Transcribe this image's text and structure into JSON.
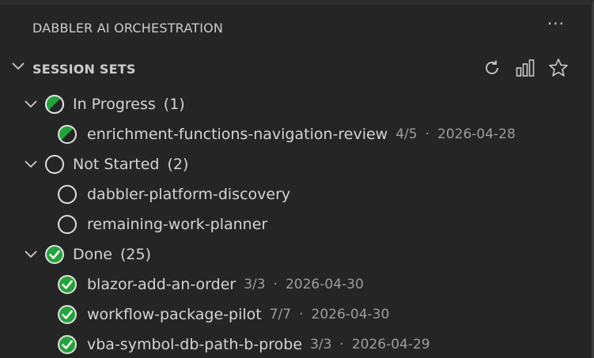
{
  "header": {
    "title": "DABBLER AI ORCHESTRATION",
    "more_label": "···",
    "more_icon": "ellipsis-icon"
  },
  "section": {
    "title": "SESSION SETS",
    "actions": [
      {
        "name": "refresh-icon"
      },
      {
        "name": "bar-chart-icon"
      },
      {
        "name": "star-icon"
      }
    ]
  },
  "colors": {
    "accent_green": "#22a43a",
    "ring": "#e0e0e0",
    "text": "#d4d4d4",
    "muted": "#9d9d9d",
    "background": "#252526"
  },
  "groups": [
    {
      "label": "In Progress",
      "count": "(1)",
      "status": "in-progress",
      "items": [
        {
          "label": "enrichment-functions-navigation-review",
          "progress": "4/5",
          "separator": "·",
          "date": "2026-04-28",
          "status": "in-progress"
        }
      ]
    },
    {
      "label": "Not Started",
      "count": "(2)",
      "status": "not-started",
      "items": [
        {
          "label": "dabbler-platform-discovery",
          "status": "not-started"
        },
        {
          "label": "remaining-work-planner",
          "status": "not-started"
        }
      ]
    },
    {
      "label": "Done",
      "count": "(25)",
      "status": "done",
      "items": [
        {
          "label": "blazor-add-an-order",
          "progress": "3/3",
          "separator": "·",
          "date": "2026-04-30",
          "status": "done"
        },
        {
          "label": "workflow-package-pilot",
          "progress": "7/7",
          "separator": "·",
          "date": "2026-04-30",
          "status": "done"
        },
        {
          "label": "vba-symbol-db-path-b-probe",
          "progress": "3/3",
          "separator": "·",
          "date": "2026-04-29",
          "status": "done"
        }
      ]
    }
  ]
}
